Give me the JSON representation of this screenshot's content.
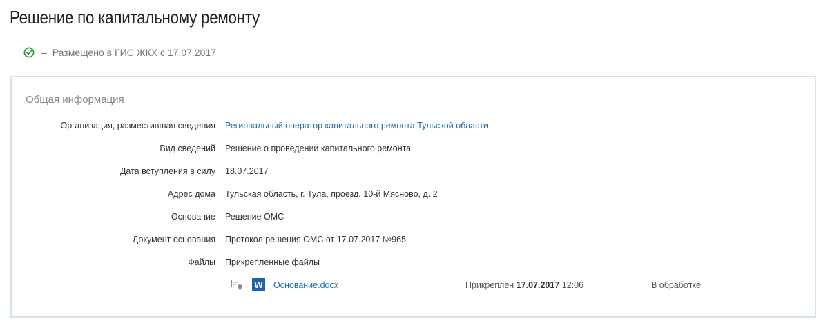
{
  "page": {
    "title": "Решение по капитальному ремонту"
  },
  "status": {
    "separator": "–",
    "text": "Размещено в ГИС ЖКХ с 17.07.2017",
    "icon": "check-circle-icon",
    "color": "#2e9e3e"
  },
  "general_info": {
    "title": "Общая информация",
    "fields": [
      {
        "label": "Организация, разместившая сведения",
        "value": "Региональный оператор капитального ремонта Тульской области",
        "is_link": true
      },
      {
        "label": "Вид сведений",
        "value": "Решение о проведении капитального ремонта",
        "is_link": false
      },
      {
        "label": "Дата вступления в силу",
        "value": "18.07.2017",
        "is_link": false
      },
      {
        "label": "Адрес дома",
        "value": "Тульская область, г. Тула, проезд. 10-й Мясново, д. 2",
        "is_link": false
      },
      {
        "label": "Основание",
        "value": "Решение ОМС",
        "is_link": false
      },
      {
        "label": "Документ основания",
        "value": "Протокол решения ОМС от 17.07.2017 №965",
        "is_link": false
      },
      {
        "label": "Файлы",
        "value": "Прикрепленные файлы",
        "is_link": false
      }
    ],
    "files": [
      {
        "signature_icon": "signature-certificate-icon",
        "type_icon": "word-document-icon",
        "type_icon_letter": "W",
        "name": "Основание.docx",
        "attached_label": "Прикреплен",
        "attached_date": "17.07.2017",
        "attached_time": "12:06",
        "status": "В обработке"
      }
    ]
  },
  "colors": {
    "link": "#1a6db3",
    "card_border": "#d6e4ef",
    "word_icon": "#1f63a8"
  }
}
